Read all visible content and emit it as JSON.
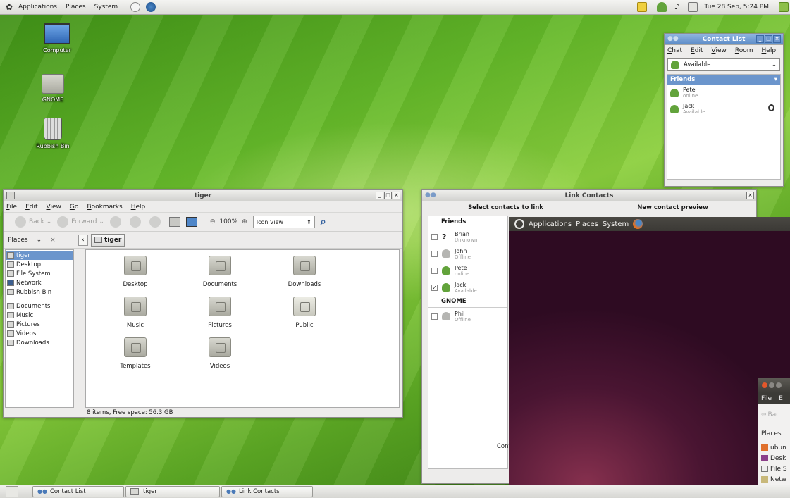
{
  "top_panel": {
    "menus": [
      "Applications",
      "Places",
      "System"
    ],
    "clock": "Tue 28 Sep, 5:24 PM",
    "foot_icon": "gnome-foot-icon",
    "launchers": [
      "home-launcher-icon",
      "web-browser-icon"
    ],
    "tray_icons": [
      "notes-icon",
      "user-status-icon",
      "volume-icon",
      "network-icon"
    ]
  },
  "desktop_icons": [
    {
      "label": "Computer",
      "icon": "computer-icon"
    },
    {
      "label": "GNOME",
      "icon": "home-folder-icon"
    },
    {
      "label": "Rubbish Bin",
      "icon": "trash-icon"
    }
  ],
  "file_manager": {
    "title": "tiger",
    "menus": [
      "File",
      "Edit",
      "View",
      "Go",
      "Bookmarks",
      "Help"
    ],
    "toolbar": {
      "back": "Back",
      "forward": "Forward",
      "zoom": "100%",
      "view_mode": "Icon View"
    },
    "places_label": "Places",
    "breadcrumb": "tiger",
    "sidebar": [
      {
        "label": "tiger",
        "selected": true
      },
      {
        "label": "Desktop",
        "selected": false
      },
      {
        "label": "File System",
        "selected": false
      },
      {
        "label": "Network",
        "selected": false
      },
      {
        "label": "Rubbish Bin",
        "selected": false
      },
      {
        "label": "Documents",
        "selected": false
      },
      {
        "label": "Music",
        "selected": false
      },
      {
        "label": "Pictures",
        "selected": false
      },
      {
        "label": "Videos",
        "selected": false
      },
      {
        "label": "Downloads",
        "selected": false
      }
    ],
    "folders": [
      "Desktop",
      "Documents",
      "Downloads",
      "Music",
      "Pictures",
      "Public",
      "Templates",
      "Videos"
    ],
    "status": "8 items, Free space: 56.3 GB"
  },
  "contact_list": {
    "title": "Contact List",
    "menus": [
      "Chat",
      "Edit",
      "View",
      "Room",
      "Help"
    ],
    "status": "Available",
    "group": "Friends",
    "contacts": [
      {
        "name": "Pete",
        "status": "online"
      },
      {
        "name": "Jack",
        "status": "Available"
      }
    ]
  },
  "link_contacts": {
    "title": "Link Contacts",
    "select_heading": "Select contacts to link",
    "preview_heading": "New contact preview",
    "groups": [
      {
        "name": "Friends",
        "rows": [
          {
            "name": "Brian",
            "status": "Unknown",
            "checked": false
          },
          {
            "name": "John",
            "status": "Offline",
            "checked": false
          },
          {
            "name": "Pete",
            "status": "online",
            "checked": false
          },
          {
            "name": "Jack",
            "status": "Available",
            "checked": true
          }
        ]
      },
      {
        "name": "GNOME",
        "rows": [
          {
            "name": "Phil",
            "status": "Offline",
            "checked": false
          }
        ]
      }
    ],
    "footer_fragment": "Cont"
  },
  "ubuntu_overlay": {
    "menus": [
      "Applications",
      "Places",
      "System"
    ],
    "nautilus_menu": [
      "File",
      "E"
    ],
    "back_fragment": "Bac",
    "places_fragment": "Places",
    "items": [
      "ubun",
      "Desk",
      "File S",
      "Netw"
    ]
  },
  "taskbar": {
    "tasks": [
      "Contact List",
      "tiger",
      "Link Contacts"
    ]
  },
  "colors": {
    "selection": "#6b95cc",
    "ubuntu_panel": "#3c3b37",
    "ubuntu_aubergine": "#4a1532",
    "wallpaper_green": "#66b92a"
  }
}
